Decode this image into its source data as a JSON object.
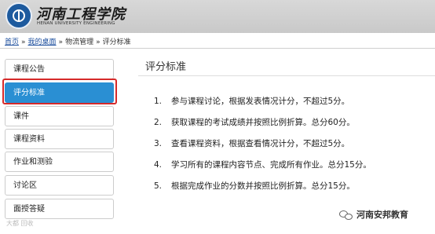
{
  "header": {
    "school_name": "河南工程学院",
    "school_name_en": "HENAN UNIVERSITY ENGINEERING"
  },
  "breadcrumb": {
    "home": "首页",
    "separator": "»",
    "desk": "我的桌面",
    "course": "物流管理",
    "current": "评分标准"
  },
  "sidebar": {
    "items": [
      {
        "label": "课程公告"
      },
      {
        "label": "评分标准"
      },
      {
        "label": "课件"
      },
      {
        "label": "课程资料"
      },
      {
        "label": "作业和测验"
      },
      {
        "label": "讨论区"
      },
      {
        "label": "面授答疑"
      }
    ],
    "active_index": 1,
    "active_color": "#2a8fd3",
    "highlight_color": "#d62a2a"
  },
  "main": {
    "title": "评分标准",
    "rules": [
      {
        "num": "1.",
        "text": "参与课程讨论，根据发表情况计分，不超过5分。"
      },
      {
        "num": "2.",
        "text": "获取课程的考试成绩并按照比例折算。总分60分。"
      },
      {
        "num": "3.",
        "text": "查看课程资料，根据查看情况计分，不超过5分。"
      },
      {
        "num": "4.",
        "text": "学习所有的课程内容节点、完成所有作业。总分15分。"
      },
      {
        "num": "5.",
        "text": "根据完成作业的分数并按照比例折算。总分15分。"
      }
    ]
  },
  "watermark": {
    "left": "大都 回收",
    "right": "河南安邦教育",
    "icon": "wechat-icon"
  }
}
